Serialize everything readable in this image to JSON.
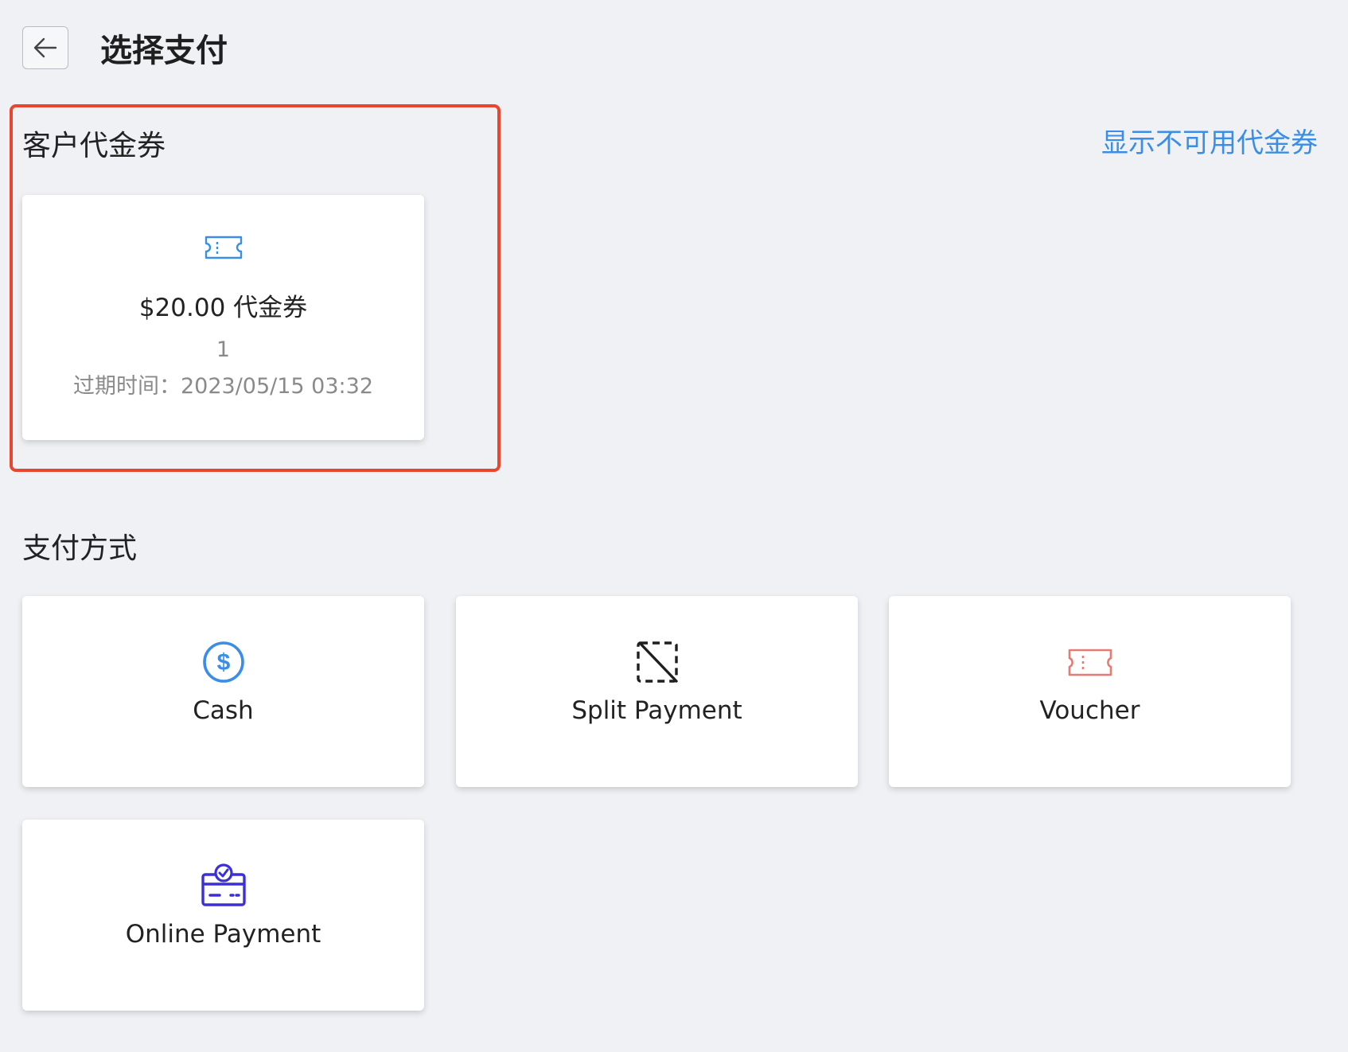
{
  "header": {
    "title": "选择支付"
  },
  "vouchers": {
    "section_title": "客户代金券",
    "show_unavailable_label": "显示不可用代金券",
    "items": [
      {
        "amount_label": "$20.00 代金券",
        "quantity": "1",
        "expiry": "过期时间：2023/05/15 03:32",
        "icon": "ticket-icon",
        "icon_color": "#3a8ee6"
      }
    ]
  },
  "payment_methods": {
    "section_title": "支付方式",
    "items": [
      {
        "label": "Cash",
        "icon": "dollar-circle-icon",
        "icon_color": "#3a8ee6"
      },
      {
        "label": "Split Payment",
        "icon": "split-payment-icon",
        "icon_color": "#1f1f1f"
      },
      {
        "label": "Voucher",
        "icon": "voucher-ticket-icon",
        "icon_color": "#e57b73"
      },
      {
        "label": "Online Payment",
        "icon": "online-payment-card-icon",
        "icon_color": "#3b2fd6"
      }
    ]
  },
  "colors": {
    "background": "#f0f1f5",
    "highlight_border": "#e8462f",
    "link": "#3a8ee6"
  }
}
